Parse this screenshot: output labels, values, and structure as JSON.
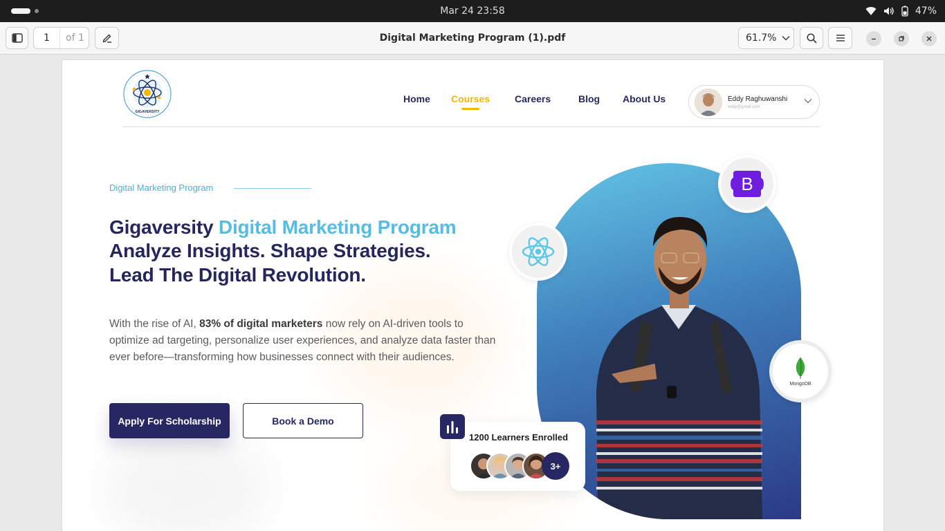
{
  "system_bar": {
    "datetime": "Mar 24  23:58",
    "battery": "47%"
  },
  "viewer": {
    "page_number": "1",
    "page_total": "of 1",
    "document_title": "Digital Marketing Program (1).pdf",
    "zoom": "61.7%"
  },
  "site": {
    "logo_text": "GIGAVERSITY",
    "nav": [
      {
        "label": "Home",
        "active": false
      },
      {
        "label": "Courses",
        "active": true
      },
      {
        "label": "Careers",
        "active": false
      },
      {
        "label": "Blog",
        "active": false
      },
      {
        "label": "About Us",
        "active": false
      }
    ],
    "user": {
      "name": "Eddy Raghuwanshi",
      "email": "eddy@gmail.com"
    }
  },
  "hero": {
    "eyebrow": "Digital Marketing Program",
    "headline": {
      "brand": "Gigaversity",
      "accent": "Digital Marketing Program",
      "line2": "Analyze Insights. Shape Strategies.",
      "line3": "Lead The Digital Revolution."
    },
    "paragraph": {
      "intro": "With the rise of AI, ",
      "highlight": "83% of digital marketers",
      "rest": " now rely on AI-driven tools to optimize ad targeting, personalize user experiences, and analyze data faster than ever before—transforming how businesses connect with their audiences."
    },
    "primary_cta": "Apply For Scholarship",
    "secondary_cta": "Book a Demo",
    "enrollment": {
      "title": "1200 Learners Enrolled",
      "more": "3+"
    },
    "tech_badges": {
      "mongodb_label": "MongoDB"
    }
  },
  "colors": {
    "navy": "#272764",
    "accent_blue": "#55bde2",
    "nav_active": "#f5b800"
  }
}
